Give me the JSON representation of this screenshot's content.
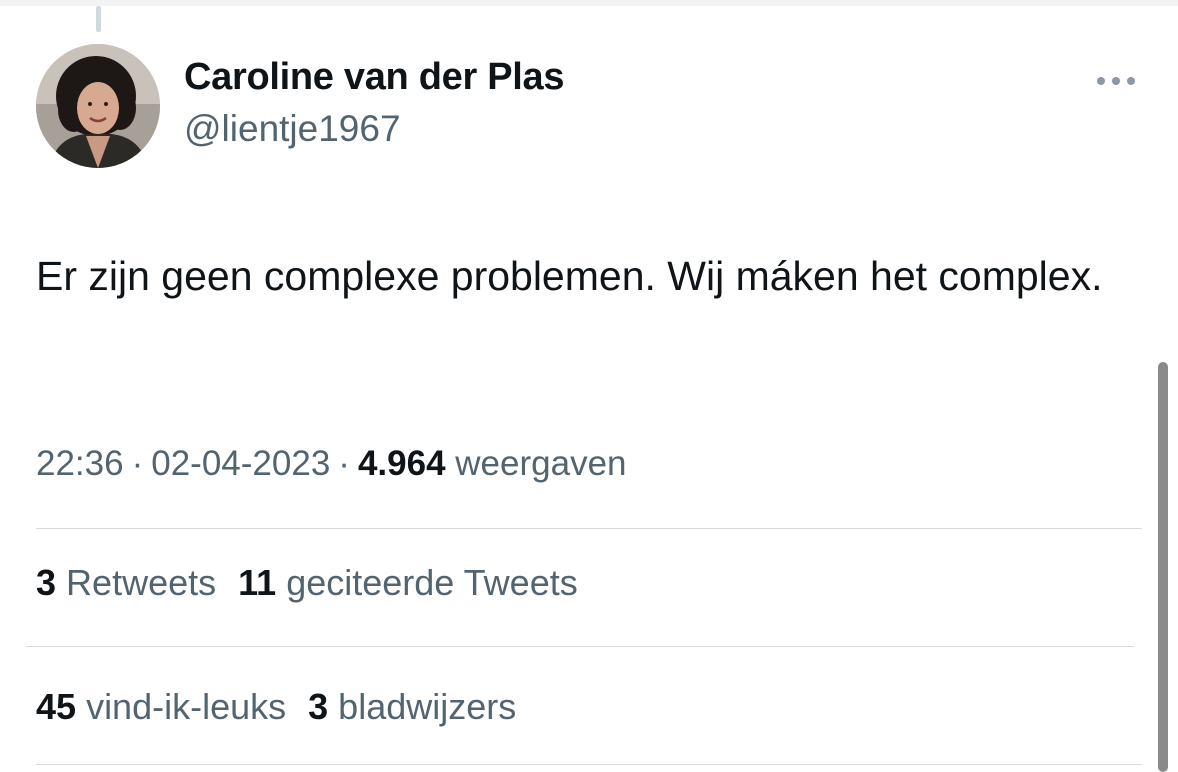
{
  "author": {
    "name": "Caroline van der Plas",
    "handle": "@lientje1967"
  },
  "tweet": {
    "text": "Er zijn geen complexe problemen. Wij máken het complex."
  },
  "meta": {
    "time": "22:36",
    "separator": "·",
    "date": "02-04-2023",
    "views_count": "4.964",
    "views_label": "weergaven"
  },
  "stats": {
    "retweets_count": "3",
    "retweets_label": "Retweets",
    "quotes_count": "11",
    "quotes_label": "geciteerde Tweets",
    "likes_count": "45",
    "likes_label": "vind-ik-leuks",
    "bookmarks_count": "3",
    "bookmarks_label": "bladwijzers"
  },
  "icons": {
    "more": "more-horizontal-icon"
  },
  "colors": {
    "text_primary": "#0f1419",
    "text_secondary": "#536471",
    "divider": "#d6dbdf"
  }
}
